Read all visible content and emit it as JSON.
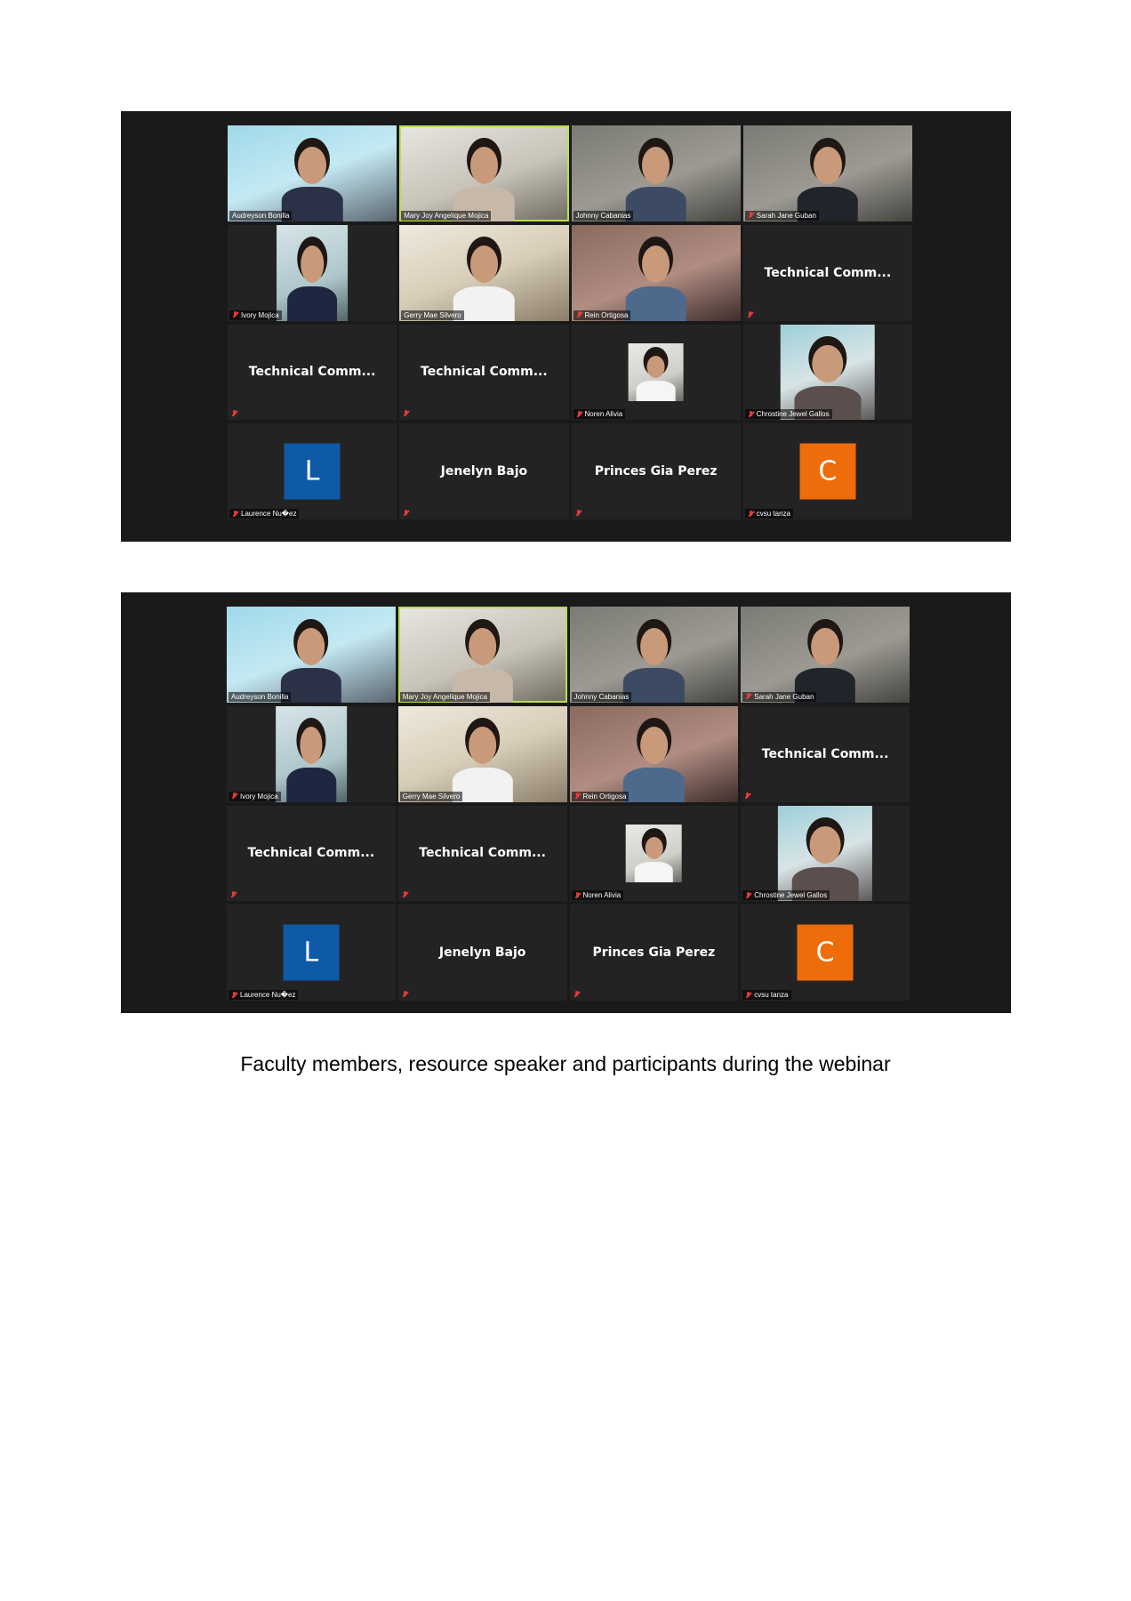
{
  "screenshots": [
    {
      "tiles": [
        {
          "type": "video",
          "name": "Audreyson Bonilla"
        },
        {
          "type": "video",
          "name": "Mary Joy Angelique Mojica",
          "active": true
        },
        {
          "type": "video",
          "name": "Johnny Cabanias"
        },
        {
          "type": "video",
          "name": "Sarah Jane Guban",
          "muted": true
        },
        {
          "type": "video",
          "name": "Ivory Mojica",
          "muted": true
        },
        {
          "type": "video",
          "name": "Gerry Mae Silvero"
        },
        {
          "type": "video",
          "name": "Rein Ortigosa",
          "muted": true
        },
        {
          "type": "name-only",
          "display_name": "Technical  Comm...",
          "muted": true
        },
        {
          "type": "name-only",
          "display_name": "Technical  Comm...",
          "muted": true
        },
        {
          "type": "name-only",
          "display_name": "Technical  Comm...",
          "muted": true
        },
        {
          "type": "video",
          "name": "Noren Alivia",
          "muted": true
        },
        {
          "type": "video",
          "name": "Chrostine Jewel Gallos",
          "muted": true
        },
        {
          "type": "avatar",
          "letter": "L",
          "color": "#0e5aa7",
          "name": "Laurence Nu�ez",
          "muted": true
        },
        {
          "type": "name-only",
          "display_name": "Jenelyn Bajo",
          "muted": true
        },
        {
          "type": "name-only",
          "display_name": "Princes Gia Perez",
          "muted": true
        },
        {
          "type": "avatar",
          "letter": "C",
          "color": "#ee6d0a",
          "name": "cvsu tanza",
          "muted": true
        }
      ]
    },
    {
      "tiles": [
        {
          "type": "video",
          "name": "Audreyson Bonilla"
        },
        {
          "type": "video",
          "name": "Mary Joy Angelique Mojica",
          "active": true
        },
        {
          "type": "video",
          "name": "Johnny Cabanias"
        },
        {
          "type": "video",
          "name": "Sarah Jane Guban",
          "muted": true
        },
        {
          "type": "video",
          "name": "Ivory Mojica",
          "muted": true
        },
        {
          "type": "video",
          "name": "Gerry Mae Silvero"
        },
        {
          "type": "video",
          "name": "Rein Ortigosa",
          "muted": true
        },
        {
          "type": "name-only",
          "display_name": "Technical  Comm...",
          "muted": true
        },
        {
          "type": "name-only",
          "display_name": "Technical  Comm...",
          "muted": true
        },
        {
          "type": "name-only",
          "display_name": "Technical  Comm...",
          "muted": true
        },
        {
          "type": "video",
          "name": "Noren Alivia",
          "muted": true
        },
        {
          "type": "video",
          "name": "Chrostine Jewel Gallos",
          "muted": true
        },
        {
          "type": "avatar",
          "letter": "L",
          "color": "#0e5aa7",
          "name": "Laurence Nu�ez",
          "muted": true
        },
        {
          "type": "name-only",
          "display_name": "Jenelyn Bajo",
          "muted": true
        },
        {
          "type": "name-only",
          "display_name": "Princes Gia Perez",
          "muted": true
        },
        {
          "type": "avatar",
          "letter": "C",
          "color": "#ee6d0a",
          "name": "cvsu tanza",
          "muted": true
        }
      ]
    }
  ],
  "caption": "Faculty members, resource speaker and participants during the webinar"
}
